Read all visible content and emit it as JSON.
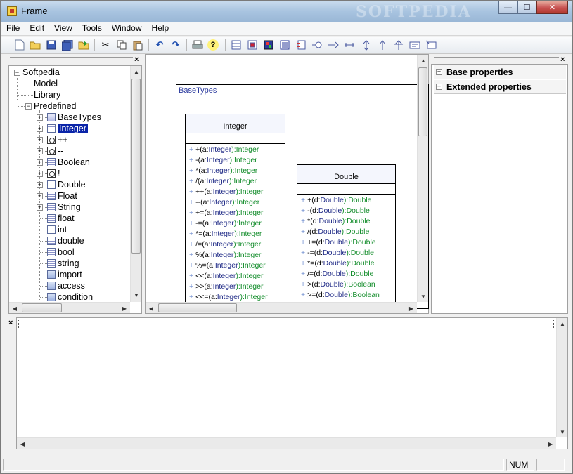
{
  "window": {
    "title": "Frame",
    "watermark": "SOFTPEDIA",
    "controls": {
      "minimize": "—",
      "maximize": "☐",
      "close": "✕"
    }
  },
  "menu": [
    "File",
    "Edit",
    "View",
    "Tools",
    "Window",
    "Help"
  ],
  "toolbar": {
    "icons": [
      "new-file-icon",
      "open-folder-icon",
      "save-icon",
      "save-all-icon",
      "export-icon",
      "cut-icon",
      "copy-icon",
      "paste-icon",
      "undo-icon",
      "redo-icon",
      "print-icon",
      "help-icon",
      "class-icon",
      "package-icon",
      "image-icon",
      "object-icon",
      "component-icon",
      "interface-icon",
      "association-icon",
      "aggregation-icon",
      "dependency-icon",
      "generalization-icon",
      "realization-icon",
      "note-icon",
      "note-link-icon"
    ]
  },
  "tree": {
    "root": "Softpedia",
    "children": [
      {
        "label": "Model"
      },
      {
        "label": "Library"
      },
      {
        "label": "Predefined"
      }
    ],
    "predefined_items": [
      {
        "label": "BaseTypes",
        "icon": "package",
        "expandable": true
      },
      {
        "label": "Integer",
        "icon": "class",
        "expandable": true,
        "selected": true
      },
      {
        "label": "++",
        "icon": "operator",
        "expandable": true
      },
      {
        "label": "--",
        "icon": "operator",
        "expandable": true
      },
      {
        "label": "Boolean",
        "icon": "class",
        "expandable": true
      },
      {
        "label": "!",
        "icon": "operator",
        "expandable": true
      },
      {
        "label": "Double",
        "icon": "class",
        "expandable": true
      },
      {
        "label": "Float",
        "icon": "class",
        "expandable": true
      },
      {
        "label": "String",
        "icon": "class",
        "expandable": true
      },
      {
        "label": "float",
        "icon": "class",
        "expandable": false
      },
      {
        "label": "int",
        "icon": "class",
        "expandable": false
      },
      {
        "label": "double",
        "icon": "class",
        "expandable": false
      },
      {
        "label": "bool",
        "icon": "class",
        "expandable": false
      },
      {
        "label": "string",
        "icon": "class",
        "expandable": false
      },
      {
        "label": "import",
        "icon": "enum",
        "expandable": false
      },
      {
        "label": "access",
        "icon": "enum",
        "expandable": false
      },
      {
        "label": "condition",
        "icon": "enum",
        "expandable": false
      }
    ]
  },
  "diagram": {
    "package_name": "BaseTypes",
    "classes": [
      {
        "name": "Integer",
        "operations": [
          {
            "name": "+(a:",
            "param": "Integer",
            "ret": "):Integer"
          },
          {
            "name": "-(a:",
            "param": "Integer",
            "ret": "):Integer"
          },
          {
            "name": "*(a:",
            "param": "Integer",
            "ret": "):Integer"
          },
          {
            "name": "/(a:",
            "param": "Integer",
            "ret": "):Integer"
          },
          {
            "name": "++(a:",
            "param": "Integer",
            "ret": "):Integer"
          },
          {
            "name": "--(a:",
            "param": "Integer",
            "ret": "):Integer"
          },
          {
            "name": "+=(a:",
            "param": "Integer",
            "ret": "):Integer"
          },
          {
            "name": "-=(a:",
            "param": "Integer",
            "ret": "):Integer"
          },
          {
            "name": "*=(a:",
            "param": "Integer",
            "ret": "):Integer"
          },
          {
            "name": "/=(a:",
            "param": "Integer",
            "ret": "):Integer"
          },
          {
            "name": "%(a:",
            "param": "Integer",
            "ret": "):Integer"
          },
          {
            "name": "%=(a:",
            "param": "Integer",
            "ret": "):Integer"
          },
          {
            "name": "<<(a:",
            "param": "Integer",
            "ret": "):Integer"
          },
          {
            "name": ">>(a:",
            "param": "Integer",
            "ret": "):Integer"
          },
          {
            "name": "<<=(a:",
            "param": "Integer",
            "ret": "):Integer"
          }
        ]
      },
      {
        "name": "Double",
        "operations": [
          {
            "name": "+(d:",
            "param": "Double",
            "ret": "):Double"
          },
          {
            "name": "-(d:",
            "param": "Double",
            "ret": "):Double"
          },
          {
            "name": "*(d:",
            "param": "Double",
            "ret": "):Double"
          },
          {
            "name": "/(d:",
            "param": "Double",
            "ret": "):Double"
          },
          {
            "name": "+=(d:",
            "param": "Double",
            "ret": "):Double"
          },
          {
            "name": "-=(d:",
            "param": "Double",
            "ret": "):Double"
          },
          {
            "name": "*=(d:",
            "param": "Double",
            "ret": "):Double"
          },
          {
            "name": "/=(d:",
            "param": "Double",
            "ret": "):Double"
          },
          {
            "name": ">(d:",
            "param": "Double",
            "ret": "):Boolean"
          },
          {
            "name": ">=(d:",
            "param": "Double",
            "ret": "):Boolean"
          }
        ]
      }
    ],
    "visibility_marker": "+"
  },
  "properties": {
    "sections": [
      "Base properties",
      "Extended properties"
    ]
  },
  "output_panel": {
    "close": "×"
  },
  "status": {
    "num": "NUM"
  },
  "colors": {
    "selection": "#0a24a8",
    "param_blue": "#1f2a86",
    "type_green": "#128c2a",
    "package_title": "#2b3a9e"
  }
}
